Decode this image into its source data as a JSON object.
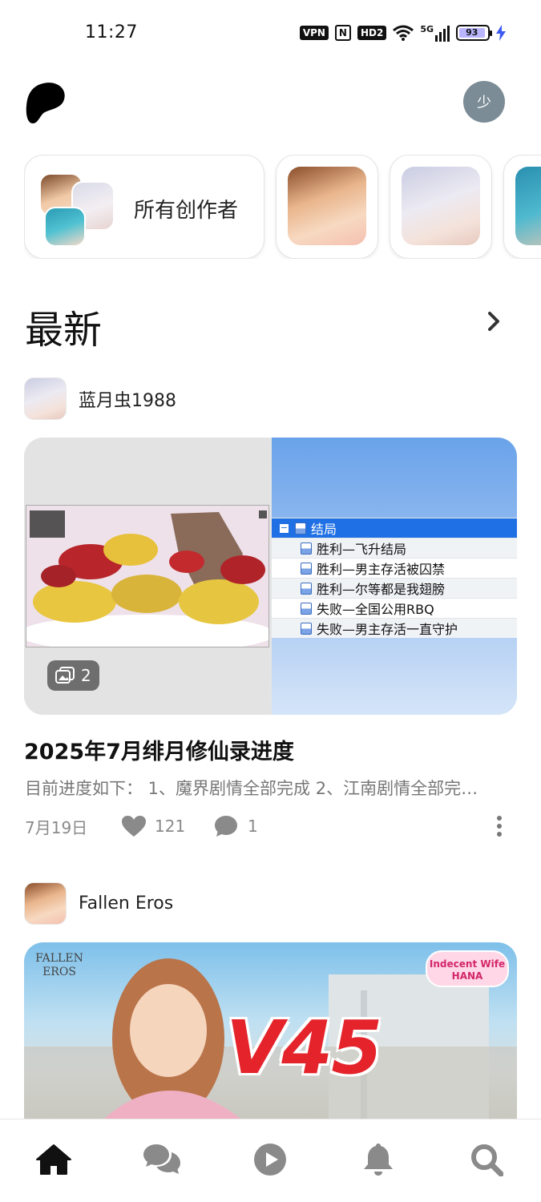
{
  "status_bar": {
    "time": "11:27",
    "vpn_label": "VPN",
    "nfc_label": "N",
    "hd_label": "HD2",
    "network_label": "5G",
    "battery_level": "93",
    "icons": [
      "vpn-icon",
      "nfc-icon",
      "hd-voice-icon",
      "wifi-icon",
      "signal-5g-icon",
      "battery-icon",
      "charging-icon"
    ]
  },
  "header": {
    "logo_icon": "patreon-logo-icon",
    "user_avatar_initial": "少"
  },
  "creators": {
    "all_label": "所有创作者",
    "cards": [
      {
        "name": "creator-fallen-eros"
      },
      {
        "name": "creator-lanyuechong"
      },
      {
        "name": "creator-blue-hair"
      }
    ]
  },
  "section": {
    "title": "最新",
    "chevron_icon": "chevron-right-icon"
  },
  "posts": [
    {
      "author": "蓝月虫1988",
      "image_count": "2",
      "tree_list": {
        "header": "结局",
        "items": [
          "胜利—飞升结局",
          "胜利—男主存活被囚禁",
          "胜利—尔等都是我翅膀",
          "失败—全国公用RBQ",
          "失败—男主存活一直守护"
        ]
      },
      "title": "2025年7月绯月修仙录进度",
      "excerpt": "目前进度如下： 1、魔界剧情全部完成 2、江南剧情全部完…",
      "date": "7月19日",
      "likes": "121",
      "comments": "1"
    },
    {
      "author": "Fallen Eros",
      "banner_studio": "FALLEN EROS",
      "banner_version": "V45",
      "banner_game_logo": "Indecent Wife HANA"
    }
  ],
  "bottom_nav": {
    "items": [
      {
        "name": "home-icon",
        "active": true
      },
      {
        "name": "chat-icon",
        "active": false
      },
      {
        "name": "play-icon",
        "active": false
      },
      {
        "name": "bell-icon",
        "active": false
      },
      {
        "name": "search-icon",
        "active": false
      }
    ]
  },
  "colors": {
    "active_icon": "#111111",
    "inactive_icon": "#8a8a8a",
    "avatar_bg": "#7b8c97",
    "tree_highlight": "#1f6fe5"
  }
}
